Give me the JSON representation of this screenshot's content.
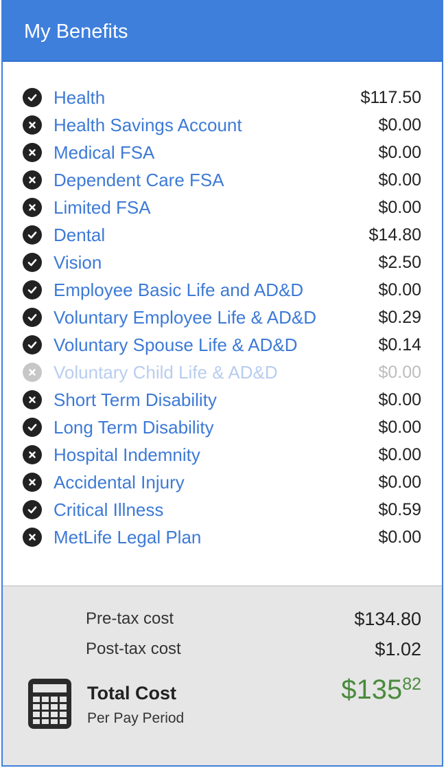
{
  "header": {
    "title": "My Benefits"
  },
  "benefits": [
    {
      "name": "Health",
      "amount": "$117.50",
      "status": "check",
      "muted": false
    },
    {
      "name": "Health Savings Account",
      "amount": "$0.00",
      "status": "x",
      "muted": false
    },
    {
      "name": "Medical FSA",
      "amount": "$0.00",
      "status": "x",
      "muted": false
    },
    {
      "name": "Dependent Care FSA",
      "amount": "$0.00",
      "status": "x",
      "muted": false
    },
    {
      "name": "Limited FSA",
      "amount": "$0.00",
      "status": "x",
      "muted": false
    },
    {
      "name": "Dental",
      "amount": "$14.80",
      "status": "check",
      "muted": false
    },
    {
      "name": "Vision",
      "amount": "$2.50",
      "status": "check",
      "muted": false
    },
    {
      "name": "Employee Basic Life and AD&D",
      "amount": "$0.00",
      "status": "check",
      "muted": false
    },
    {
      "name": "Voluntary Employee Life & AD&D",
      "amount": "$0.29",
      "status": "check",
      "muted": false
    },
    {
      "name": "Voluntary Spouse Life & AD&D",
      "amount": "$0.14",
      "status": "check",
      "muted": false
    },
    {
      "name": "Voluntary Child Life & AD&D",
      "amount": "$0.00",
      "status": "x",
      "muted": true
    },
    {
      "name": "Short Term Disability",
      "amount": "$0.00",
      "status": "x",
      "muted": false
    },
    {
      "name": "Long Term Disability",
      "amount": "$0.00",
      "status": "check",
      "muted": false
    },
    {
      "name": "Hospital Indemnity",
      "amount": "$0.00",
      "status": "x",
      "muted": false
    },
    {
      "name": "Accidental Injury",
      "amount": "$0.00",
      "status": "x",
      "muted": false
    },
    {
      "name": "Critical Illness",
      "amount": "$0.59",
      "status": "check",
      "muted": false
    },
    {
      "name": "MetLife Legal Plan",
      "amount": "$0.00",
      "status": "x",
      "muted": false
    }
  ],
  "summary": {
    "pretax_label": "Pre-tax cost",
    "pretax_value": "$134.80",
    "posttax_label": "Post-tax cost",
    "posttax_value": "$1.02",
    "total_label": "Total Cost",
    "total_sublabel": "Per Pay Period",
    "total_dollars": "$135",
    "total_cents": "82",
    "total_icon": "calculator-icon"
  },
  "colors": {
    "header_bg": "#3f7fdc",
    "link": "#3d7ad6",
    "total_green": "#4a8a3c",
    "footer_bg": "#e6e6e6"
  }
}
